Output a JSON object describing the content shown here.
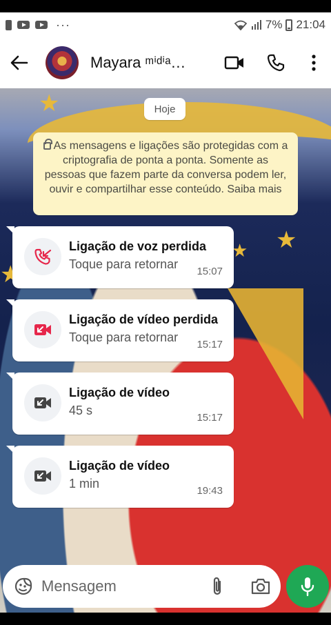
{
  "status_bar": {
    "battery": "7%",
    "time": "21:04",
    "icons": [
      "notification-icon",
      "youtube-icon",
      "youtube-icon",
      "more-dots-icon",
      "wifi-icon",
      "signal-icon",
      "battery-icon"
    ]
  },
  "header": {
    "contact_name": "Mayara ᵐⁱᵈⁱᵃ…",
    "icons": [
      "back-arrow-icon",
      "video-call-icon",
      "voice-call-icon",
      "overflow-menu-icon"
    ]
  },
  "chat": {
    "date_chip": "Hoje",
    "encryption_notice": "As mensagens e ligações são protegidas com a criptografia de ponta a ponta. Somente as pessoas que fazem parte da conversa podem ler, ouvir e compartilhar esse conteúdo. Saiba mais",
    "calls": [
      {
        "type": "voice-missed",
        "title": "Ligação de voz perdida",
        "subtitle": "Toque para retornar",
        "time": "15:07",
        "icon": "missed-voice-call-icon",
        "icon_color": "#e6274b"
      },
      {
        "type": "video-missed",
        "title": "Ligação de vídeo perdida",
        "subtitle": "Toque para retornar",
        "time": "15:17",
        "icon": "missed-video-call-icon",
        "icon_color": "#e6274b"
      },
      {
        "type": "video",
        "title": "Ligação de vídeo",
        "subtitle": "45 s",
        "time": "15:17",
        "icon": "video-call-icon",
        "icon_color": "#444444"
      },
      {
        "type": "video",
        "title": "Ligação de vídeo",
        "subtitle": "1 min",
        "time": "19:43",
        "icon": "video-call-icon",
        "icon_color": "#444444"
      }
    ]
  },
  "composer": {
    "placeholder": "Mensagem",
    "icons": [
      "sticker-icon",
      "attach-icon",
      "camera-icon",
      "mic-icon"
    ],
    "accent": "#1fa855"
  }
}
